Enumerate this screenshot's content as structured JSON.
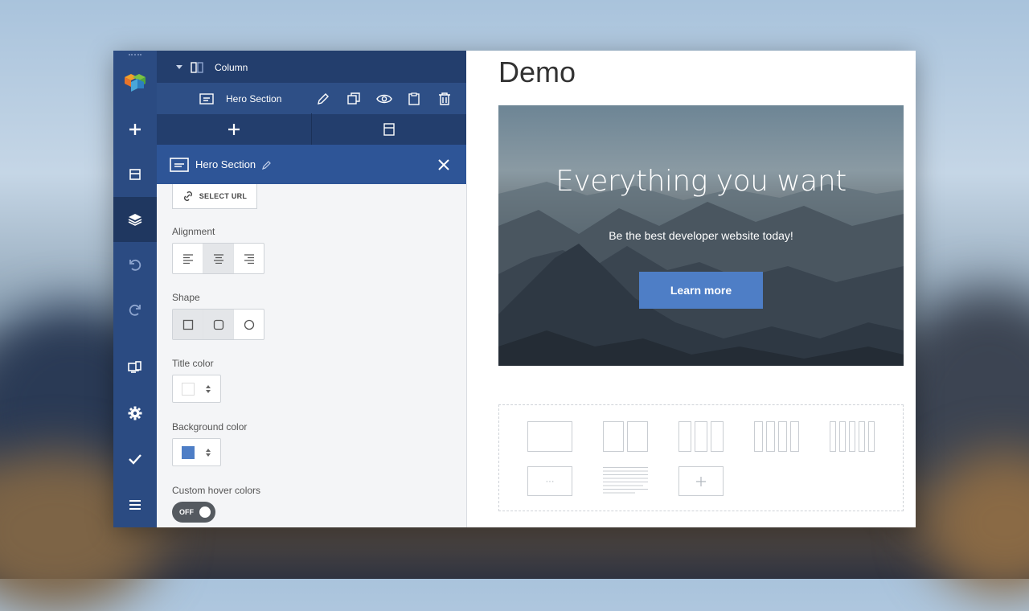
{
  "tree": {
    "column_label": "Column",
    "hero_section_label": "Hero Section"
  },
  "panel": {
    "title": "Hero Section",
    "select_url_label": "SELECT URL",
    "alignment_label": "Alignment",
    "shape_label": "Shape",
    "title_color_label": "Title color",
    "background_color_label": "Background color",
    "custom_hover_label": "Custom hover colors",
    "toggle_state": "OFF",
    "title_color_value": "#ffffff",
    "background_color_value": "#4e7ec6"
  },
  "content": {
    "page_title": "Demo",
    "hero_title": "Everything you want",
    "hero_subtitle": "Be the best developer website today!",
    "hero_button": "Learn more",
    "more_label": "···"
  },
  "colors": {
    "rail": "#2b4b82",
    "tree": "#233e6d",
    "panel_header": "#2e5597",
    "accent": "#4e7ec6"
  }
}
